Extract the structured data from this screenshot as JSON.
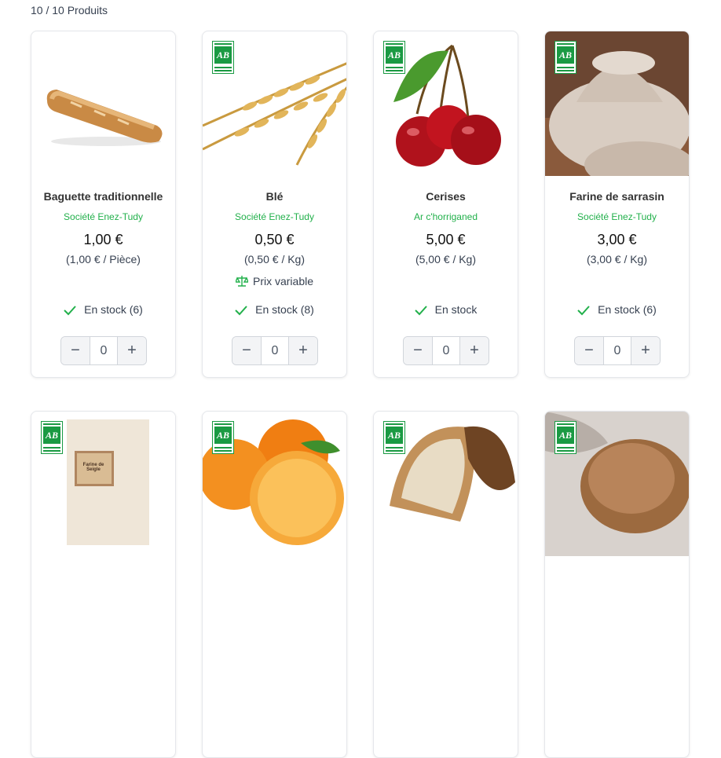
{
  "header": {
    "count": "10 / 10 Produits"
  },
  "label_bio": "AB",
  "products": [
    {
      "name": "Baguette traditionnelle",
      "vendor": "Société Enez-Tudy",
      "price": "1,00 €",
      "unit_price": "(1,00 € / Pièce)",
      "stock": "En stock (6)",
      "qty": "0",
      "bio": false
    },
    {
      "name": "Blé",
      "vendor": "Société Enez-Tudy",
      "price": "0,50 €",
      "unit_price": "(0,50 € / Kg)",
      "variable": "Prix variable",
      "stock": "En stock (8)",
      "qty": "0",
      "bio": true
    },
    {
      "name": "Cerises",
      "vendor": "Ar c'horriganed",
      "price": "5,00 €",
      "unit_price": "(5,00 € / Kg)",
      "stock": "En stock",
      "qty": "0",
      "bio": true
    },
    {
      "name": "Farine de sarrasin",
      "vendor": "Société Enez-Tudy",
      "price": "3,00 €",
      "unit_price": "(3,00 € / Kg)",
      "stock": "En stock (6)",
      "qty": "0",
      "bio": true
    }
  ],
  "row2_bag_label": "Farine de Seigle",
  "colors": {
    "accent": "#22b04b",
    "bio_green": "#1a9a43"
  }
}
